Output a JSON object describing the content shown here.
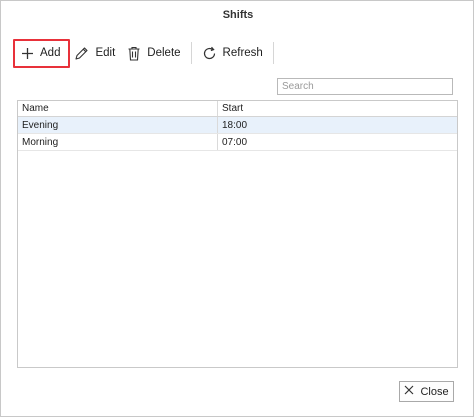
{
  "window": {
    "title": "Shifts"
  },
  "toolbar": {
    "add_label": "Add",
    "edit_label": "Edit",
    "delete_label": "Delete",
    "refresh_label": "Refresh",
    "icons": {
      "add": "plus-icon",
      "edit": "pencil-icon",
      "delete": "trash-icon",
      "refresh": "refresh-icon"
    },
    "highlight_color": "#e8313a"
  },
  "search": {
    "placeholder": "Search",
    "value": ""
  },
  "grid": {
    "columns": [
      "Name",
      "Start"
    ],
    "rows": [
      {
        "name": "Evening",
        "start": "18:00",
        "selected": true
      },
      {
        "name": "Morning",
        "start": "07:00",
        "selected": false
      }
    ],
    "selected_row_color": "#e8f1fb"
  },
  "footer": {
    "close_label": "Close",
    "close_icon": "close-icon"
  }
}
